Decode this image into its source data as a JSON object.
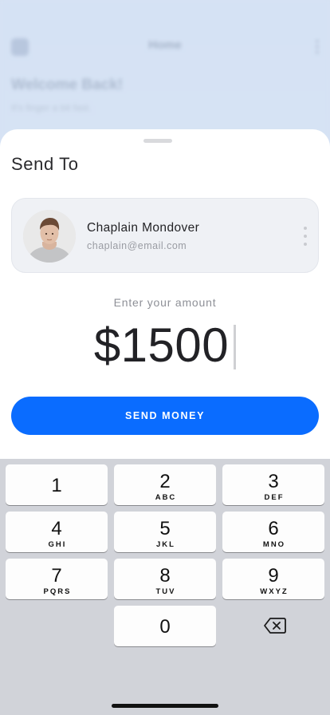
{
  "background": {
    "title": "Home",
    "welcome": "Welcome Back!",
    "subtitle": "It's finger a bit fast."
  },
  "sheet": {
    "title": "Send To",
    "recipient": {
      "name": "Chaplain Mondover",
      "email": "chaplain@email.com"
    },
    "amount_label": "Enter your amount",
    "amount": "$1500",
    "send_button": "SEND MONEY"
  },
  "keyboard": {
    "keys": [
      {
        "digit": "1",
        "letters": ""
      },
      {
        "digit": "2",
        "letters": "ABC"
      },
      {
        "digit": "3",
        "letters": "DEF"
      },
      {
        "digit": "4",
        "letters": "GHI"
      },
      {
        "digit": "5",
        "letters": "JKL"
      },
      {
        "digit": "6",
        "letters": "MNO"
      },
      {
        "digit": "7",
        "letters": "PQRS"
      },
      {
        "digit": "8",
        "letters": "TUV"
      },
      {
        "digit": "9",
        "letters": "WXYZ"
      },
      {
        "digit": "0",
        "letters": ""
      }
    ],
    "backspace_icon": "delete-left-icon"
  },
  "colors": {
    "accent": "#0a6cff",
    "keyboard_bg": "#d1d3d9"
  }
}
